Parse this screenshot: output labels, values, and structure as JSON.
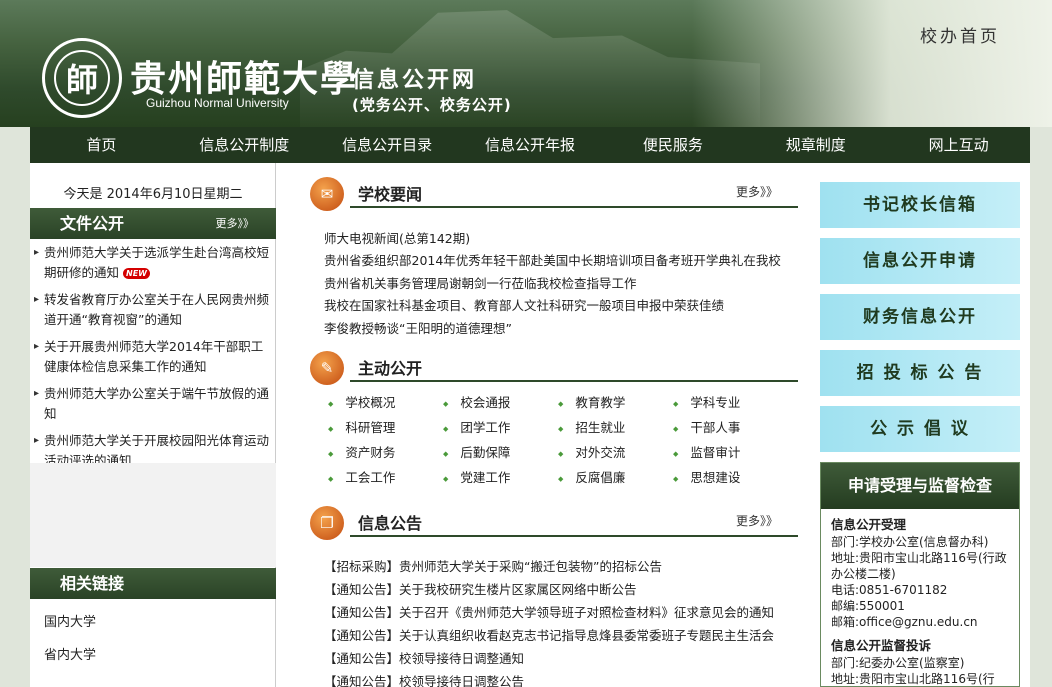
{
  "header": {
    "seal_char": "師",
    "university_name": "贵州師範大學",
    "university_en": "Guizhou Normal University",
    "site_title": "信息公开网",
    "site_subtitle": "(党务公开、校务公开)",
    "home_link": "校办首页"
  },
  "nav": {
    "items": [
      "首页",
      "信息公开制度",
      "信息公开目录",
      "信息公开年报",
      "便民服务",
      "规章制度",
      "网上互动"
    ]
  },
  "left": {
    "date": "今天是 2014年6月10日星期二",
    "docs_title": "文件公开",
    "docs_more": "更多》》",
    "new_badge": "NEW",
    "docs": [
      "贵州师范大学关于选派学生赴台湾高校短期研修的通知",
      "转发省教育厅办公室关于在人民网贵州频道开通“教育视窗”的通知",
      "关于开展贵州师范大学2014年干部职工健康体检信息采集工作的通知",
      "贵州师范大学办公室关于端午节放假的通知",
      "贵州师范大学关于开展校园阳光体育运动活动评选的通知"
    ],
    "links_title": "相关链接",
    "links": [
      "国内大学",
      "省内大学"
    ]
  },
  "center": {
    "news": {
      "title": "学校要闻",
      "more": "更多》》",
      "items": [
        "师大电视新闻(总第142期)",
        "贵州省委组织部2014年优秀年轻干部赴美国中长期培训项目备考班开学典礼在我校",
        "贵州省机关事务管理局谢朝剑一行莅临我校检查指导工作",
        "我校在国家社科基金项目、教育部人文社科研究一般项目申报中荣获佳绩",
        "李俊教授畅谈“王阳明的道德理想”"
      ]
    },
    "active": {
      "title": "主动公开",
      "items": [
        "学校概况",
        "校会通报",
        "教育教学",
        "学科专业",
        "科研管理",
        "团学工作",
        "招生就业",
        "干部人事",
        "资产财务",
        "后勤保障",
        "对外交流",
        "监督审计",
        "工会工作",
        "党建工作",
        "反腐倡廉",
        "思想建设"
      ]
    },
    "notices": {
      "title": "信息公告",
      "more": "更多》》",
      "items": [
        "【招标采购】贵州师范大学关于采购“搬迁包装物”的招标公告",
        "【通知公告】关于我校研究生楼片区家属区网络中断公告",
        "【通知公告】关于召开《贵州师范大学领导班子对照检查材料》征求意见会的通知",
        "【通知公告】关于认真组织收看赵克志书记指导息烽县委常委班子专题民主生活会",
        "【通知公告】校领导接待日调整通知",
        "【通知公告】校领导接待日调整公告"
      ]
    }
  },
  "right": {
    "buttons": [
      "书记校长信箱",
      "信息公开申请",
      "财务信息公开",
      "招 投 标 公 告",
      "公 示 倡 议"
    ],
    "service": {
      "title": "申请受理与监督检查",
      "accept_title": "信息公开受理",
      "accept_lines": [
        "部门:学校办公室(信息督办科)",
        "地址:贵阳市宝山北路116号(行政办公楼二楼)",
        "电话:0851-6701182",
        "邮编:550001",
        "邮箱:office@gznu.edu.cn"
      ],
      "complaint_title": "信息公开监督投诉",
      "complaint_lines": [
        "部门:纪委办公室(监察室)",
        "地址:贵阳市宝山北路116号(行"
      ]
    }
  },
  "colors": {
    "nav_bg": "#22371f",
    "accent_green": "#2e4a2a",
    "cyan_button": "#9fe1f0",
    "bullet_green": "#4a9a3a"
  }
}
